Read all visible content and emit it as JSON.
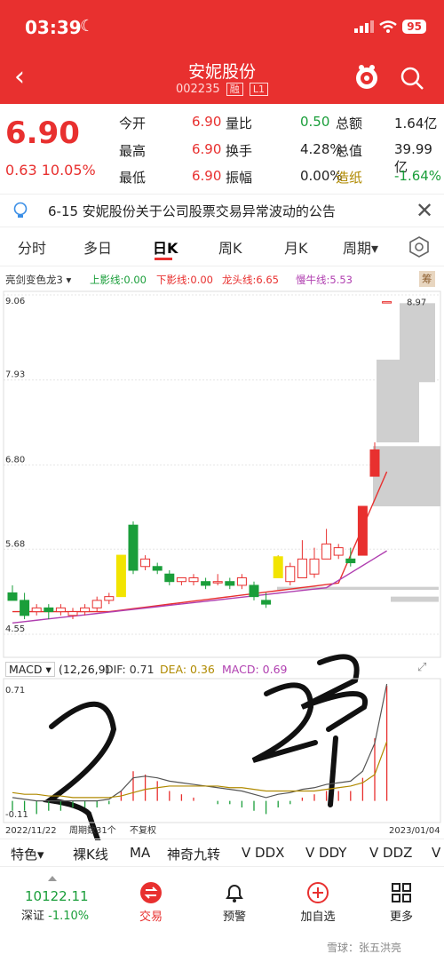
{
  "status": {
    "time": "03:39",
    "battery": "95"
  },
  "header": {
    "title": "安妮股份",
    "code": "002235",
    "tag1": "融",
    "tag2": "L1"
  },
  "quote": {
    "price": "6.90",
    "change": "0.63",
    "change_pct": "10.05%",
    "rows": [
      {
        "l1": "今开",
        "v1": "6.90",
        "l2": "量比",
        "v2": "0.50",
        "l3": "总额",
        "v3": "1.64亿"
      },
      {
        "l1": "最高",
        "v1": "6.90",
        "l2": "换手",
        "v2": "4.28%",
        "l3": "总值",
        "v3": "39.99亿"
      },
      {
        "l1": "最低",
        "v1": "6.90",
        "l2": "振幅",
        "v2": "0.00%",
        "l3": "造纸",
        "v3": "-1.64%"
      }
    ]
  },
  "news": {
    "text": "6-15 安妮股份关于公司股票交易异常波动的公告"
  },
  "tabs": [
    "分时",
    "多日",
    "日K",
    "周K",
    "月K",
    "周期▾"
  ],
  "indicator": {
    "name": "亮剑变色龙3",
    "items": [
      {
        "label": "上影线:0.00",
        "color": "#1a9e3a"
      },
      {
        "label": "下影线:0.00",
        "color": "#e8302f"
      },
      {
        "label": "龙头线:6.65",
        "color": "#e8302f"
      },
      {
        "label": "慢牛线:5.53",
        "color": "#b03fb0"
      }
    ],
    "badge": "筹"
  },
  "chart_data": {
    "type": "candlestick",
    "y_ticks": [
      "9.06",
      "7.93",
      "6.80",
      "5.68",
      "4.55"
    ],
    "max_label": "8.97",
    "start_date": "2022/11/22",
    "end_date": "2023/01/04",
    "period_count": "周期数31个",
    "adjust": "不复权",
    "annotations": [
      "2",
      "23"
    ],
    "candles": [
      [
        5.1,
        5.2,
        5.0,
        5.0
      ],
      [
        5.0,
        5.1,
        4.75,
        4.8
      ],
      [
        4.85,
        4.95,
        4.8,
        4.9
      ],
      [
        4.9,
        4.95,
        4.75,
        4.85
      ],
      [
        4.85,
        4.95,
        4.8,
        4.9
      ],
      [
        4.8,
        4.9,
        4.75,
        4.85
      ],
      [
        4.85,
        4.95,
        4.8,
        4.9
      ],
      [
        4.9,
        5.05,
        4.85,
        5.0
      ],
      [
        5.0,
        5.1,
        4.95,
        5.05
      ],
      [
        5.05,
        5.6,
        5.05,
        5.6
      ],
      [
        6.0,
        6.05,
        5.35,
        5.4
      ],
      [
        5.45,
        5.6,
        5.4,
        5.55
      ],
      [
        5.45,
        5.5,
        5.35,
        5.4
      ],
      [
        5.35,
        5.4,
        5.2,
        5.25
      ],
      [
        5.25,
        5.3,
        5.2,
        5.3
      ],
      [
        5.25,
        5.35,
        5.2,
        5.3
      ],
      [
        5.25,
        5.3,
        5.15,
        5.2
      ],
      [
        5.25,
        5.35,
        5.2,
        5.25
      ],
      [
        5.25,
        5.3,
        5.15,
        5.2
      ],
      [
        5.2,
        5.35,
        5.15,
        5.3
      ],
      [
        5.2,
        5.25,
        5.0,
        5.05
      ],
      [
        5.0,
        5.1,
        4.9,
        4.95
      ],
      [
        5.3,
        5.6,
        5.3,
        5.58
      ],
      [
        5.25,
        5.5,
        5.2,
        5.45
      ],
      [
        5.3,
        5.8,
        5.3,
        5.55
      ],
      [
        5.35,
        5.7,
        5.3,
        5.55
      ],
      [
        5.55,
        5.95,
        5.55,
        5.75
      ],
      [
        5.6,
        5.75,
        5.55,
        5.7
      ],
      [
        5.55,
        5.7,
        5.45,
        5.5
      ],
      [
        5.6,
        6.25,
        5.6,
        6.25
      ],
      [
        6.65,
        7.1,
        6.65,
        7.0
      ],
      [
        8.97,
        8.97,
        8.97,
        8.97
      ]
    ]
  },
  "macd": {
    "name": "MACD",
    "params": "(12,26,9)",
    "dif": "DIF: 0.71",
    "dea": "DEA: 0.36",
    "macd": "MACD: 0.69",
    "top": "0.71",
    "bottom": "-0.11"
  },
  "tools": [
    "特色▾",
    "裸K线",
    "MA",
    "神奇九转",
    "V DDX",
    "V DDY",
    "V DDZ",
    "V"
  ],
  "index": {
    "value": "10122.11",
    "name": "深证",
    "change": "-1.10%"
  },
  "nav": [
    "交易",
    "预警",
    "加自选",
    "更多"
  ],
  "watermark": "雪球：张五洪亮",
  "colors": {
    "up": "#e8302f",
    "down": "#1a9e3a",
    "brand": "#e8302f"
  }
}
